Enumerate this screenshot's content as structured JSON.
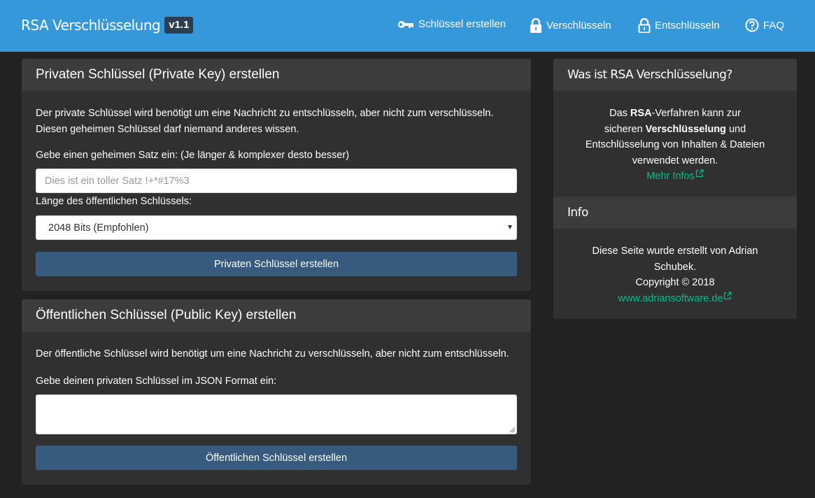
{
  "navbar": {
    "brand_title": "RSA Verschlüsselung",
    "version": "v1.1",
    "items": [
      {
        "label": "Schlüssel erstellen",
        "icon": "key-icon"
      },
      {
        "label": "Verschlüsseln",
        "icon": "lock-closed-icon"
      },
      {
        "label": "Entschlüsseln",
        "icon": "lock-open-icon"
      },
      {
        "label": "FAQ",
        "icon": "question-circle-icon"
      }
    ]
  },
  "private_key_panel": {
    "title": "Privaten Schlüssel (Private Key) erstellen",
    "description_line1": "Der private Schlüssel wird benötigt um eine Nachricht zu entschlüsseln, aber nicht zum verschlüsseln.",
    "description_line2": "Diesen geheimen Schlüssel darf niemand anderes wissen.",
    "phrase_label": "Gebe einen geheimen Satz ein: (Je länger & komplexer desto besser)",
    "phrase_placeholder": "Dies ist ein toller Satz !+*#17%3",
    "length_label": "Länge des öffentlichen Schlüssels:",
    "length_selected": "2048 Bits (Empfohlen)",
    "button_label": "Privaten Schlüssel erstellen"
  },
  "public_key_panel": {
    "title": "Öffentlichen Schlüssel (Public Key) erstellen",
    "description": "Der öffentliche Schlüssel wird benötigt um eine Nachricht zu verschlüsseln, aber nicht zum entschlüsseln.",
    "json_label": "Gebe deinen privaten Schlüssel im JSON Format ein:",
    "textarea_value": "",
    "button_label": "Öffentlichen Schlüssel erstellen"
  },
  "about_panel": {
    "title": "Was ist RSA Verschlüsselung?",
    "text_1": "Das ",
    "text_rsa": "RSA",
    "text_2": "-Verfahren kann zur",
    "text_3": "sicheren ",
    "text_encryption": "Verschlüsselung",
    "text_4": " und",
    "text_5": "Entschlüsselung von Inhalten & Dateien",
    "text_6": "verwendet werden.",
    "more_link": "Mehr Infos"
  },
  "info_panel": {
    "title": "Info",
    "line1": "Diese Seite wurde erstellt von Adrian",
    "line2": "Schubek.",
    "copyright": "Copyright © 2018",
    "website_link": "www.adriansoftware.de"
  },
  "colors": {
    "navbar": "#3498db",
    "background": "#222222",
    "panel": "#303030",
    "panel_heading": "#3c3c3c",
    "button": "#375a7f",
    "link": "#00bc8c",
    "badge": "#2c3e50"
  }
}
